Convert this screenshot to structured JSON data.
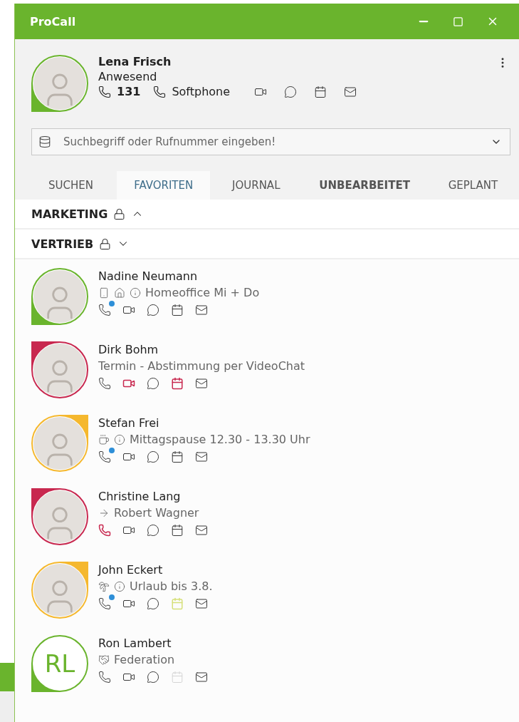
{
  "window": {
    "title": "ProCall"
  },
  "user": {
    "name": "Lena Frisch",
    "status": "Anwesend",
    "presence": {
      "kind": "available",
      "color": "#6ab42d"
    },
    "avatar": {
      "kind": "photo"
    },
    "extension": "131",
    "device": "Softphone"
  },
  "search": {
    "placeholder": "Suchbegriff oder Rufnummer eingeben!"
  },
  "tabs": [
    {
      "label": "SUCHEN",
      "selected": false,
      "unread": false
    },
    {
      "label": "FAVORITEN",
      "selected": true,
      "unread": false
    },
    {
      "label": "JOURNAL",
      "selected": false,
      "unread": false
    },
    {
      "label": "UNBEARBEITET",
      "selected": false,
      "unread": true
    },
    {
      "label": "GEPLANT",
      "selected": false,
      "unread": false
    }
  ],
  "groups": [
    {
      "name": "MARKETING",
      "locked": true,
      "expanded": false
    },
    {
      "name": "VERTRIEB",
      "locked": true,
      "expanded": true,
      "contacts": [
        {
          "name": "Nadine Neumann",
          "presence": {
            "kind": "available",
            "color": "#6ab42d"
          },
          "avatar": {
            "kind": "photo"
          },
          "status_icons": [
            {
              "kind": "mobile"
            },
            {
              "kind": "home"
            },
            {
              "kind": "info"
            }
          ],
          "status": "Homeoffice Mi + Do",
          "actions": [
            {
              "kind": "phone",
              "badge": true
            },
            {
              "kind": "video"
            },
            {
              "kind": "chat"
            },
            {
              "kind": "calendar"
            },
            {
              "kind": "mail"
            }
          ]
        },
        {
          "name": "Dirk Bohm",
          "presence": {
            "kind": "busy",
            "color": "#c8284f"
          },
          "avatar": {
            "kind": "photo"
          },
          "status": "Termin - Abstimmung per VideoChat",
          "actions": [
            {
              "kind": "phone"
            },
            {
              "kind": "video",
              "color": "#c8284f"
            },
            {
              "kind": "chat"
            },
            {
              "kind": "calendar",
              "color": "#c8284f"
            },
            {
              "kind": "mail"
            }
          ]
        },
        {
          "name": "Stefan Frei",
          "presence": {
            "kind": "away",
            "color": "#f5b82e"
          },
          "avatar": {
            "kind": "photo"
          },
          "status_icons": [
            {
              "kind": "cup"
            },
            {
              "kind": "info"
            }
          ],
          "status": "Mittagspause 12.30 - 13.30 Uhr",
          "actions": [
            {
              "kind": "phone",
              "badge": true
            },
            {
              "kind": "video"
            },
            {
              "kind": "chat"
            },
            {
              "kind": "calendar"
            },
            {
              "kind": "mail"
            }
          ]
        },
        {
          "name": "Christine Lang",
          "presence": {
            "kind": "busy",
            "color": "#c8284f"
          },
          "avatar": {
            "kind": "photo"
          },
          "status_icons": [
            {
              "kind": "arrow"
            }
          ],
          "status": "Robert Wagner",
          "actions": [
            {
              "kind": "phone",
              "color": "#c8284f"
            },
            {
              "kind": "video"
            },
            {
              "kind": "chat"
            },
            {
              "kind": "calendar"
            },
            {
              "kind": "mail"
            }
          ]
        },
        {
          "name": "John Eckert",
          "presence": {
            "kind": "away",
            "color": "#f5b82e"
          },
          "avatar": {
            "kind": "photo"
          },
          "status_icons": [
            {
              "kind": "palm"
            },
            {
              "kind": "info"
            }
          ],
          "status": "Urlaub bis 3.8.",
          "actions": [
            {
              "kind": "phone",
              "badge": true
            },
            {
              "kind": "video"
            },
            {
              "kind": "chat"
            },
            {
              "kind": "calendar",
              "color": "#d6e07a"
            },
            {
              "kind": "mail"
            }
          ]
        },
        {
          "name": "Ron Lambert",
          "presence": {
            "kind": "available",
            "color": "#6ab42d"
          },
          "avatar": {
            "kind": "initials",
            "initials": "RL"
          },
          "status_icons": [
            {
              "kind": "federation"
            }
          ],
          "status": "Federation",
          "actions": [
            {
              "kind": "phone"
            },
            {
              "kind": "video"
            },
            {
              "kind": "chat"
            },
            {
              "kind": "calendar",
              "disabled": true
            },
            {
              "kind": "mail"
            }
          ]
        }
      ]
    }
  ]
}
